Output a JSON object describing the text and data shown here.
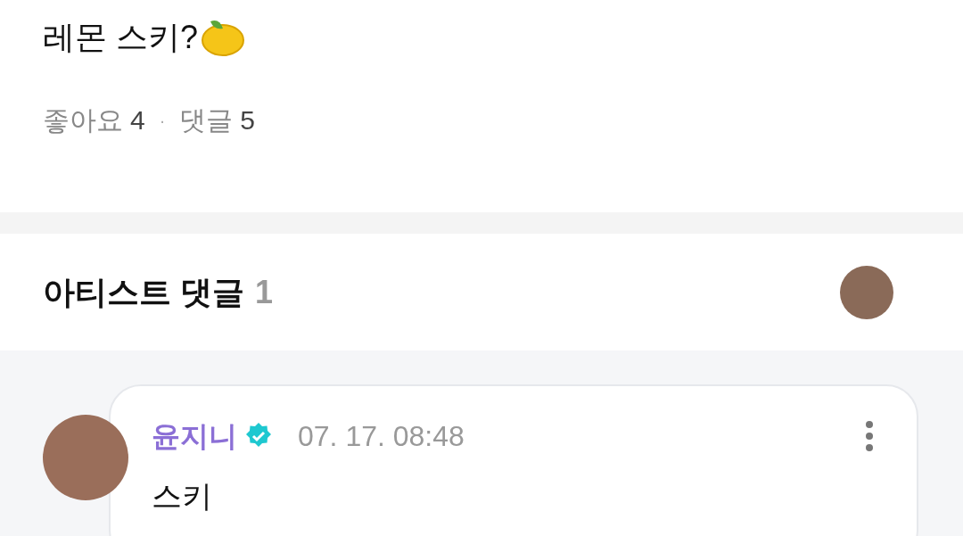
{
  "post": {
    "text": "레몬 스키?",
    "likes_label": "좋아요",
    "likes_count": "4",
    "separator": "·",
    "comments_label": "댓글",
    "comments_count": "5"
  },
  "artist_comments": {
    "title": "아티스트 댓글",
    "count": "1",
    "comments": [
      {
        "author": "윤지니",
        "verified": true,
        "time": "07. 17. 08:48",
        "text": "스키"
      }
    ]
  }
}
